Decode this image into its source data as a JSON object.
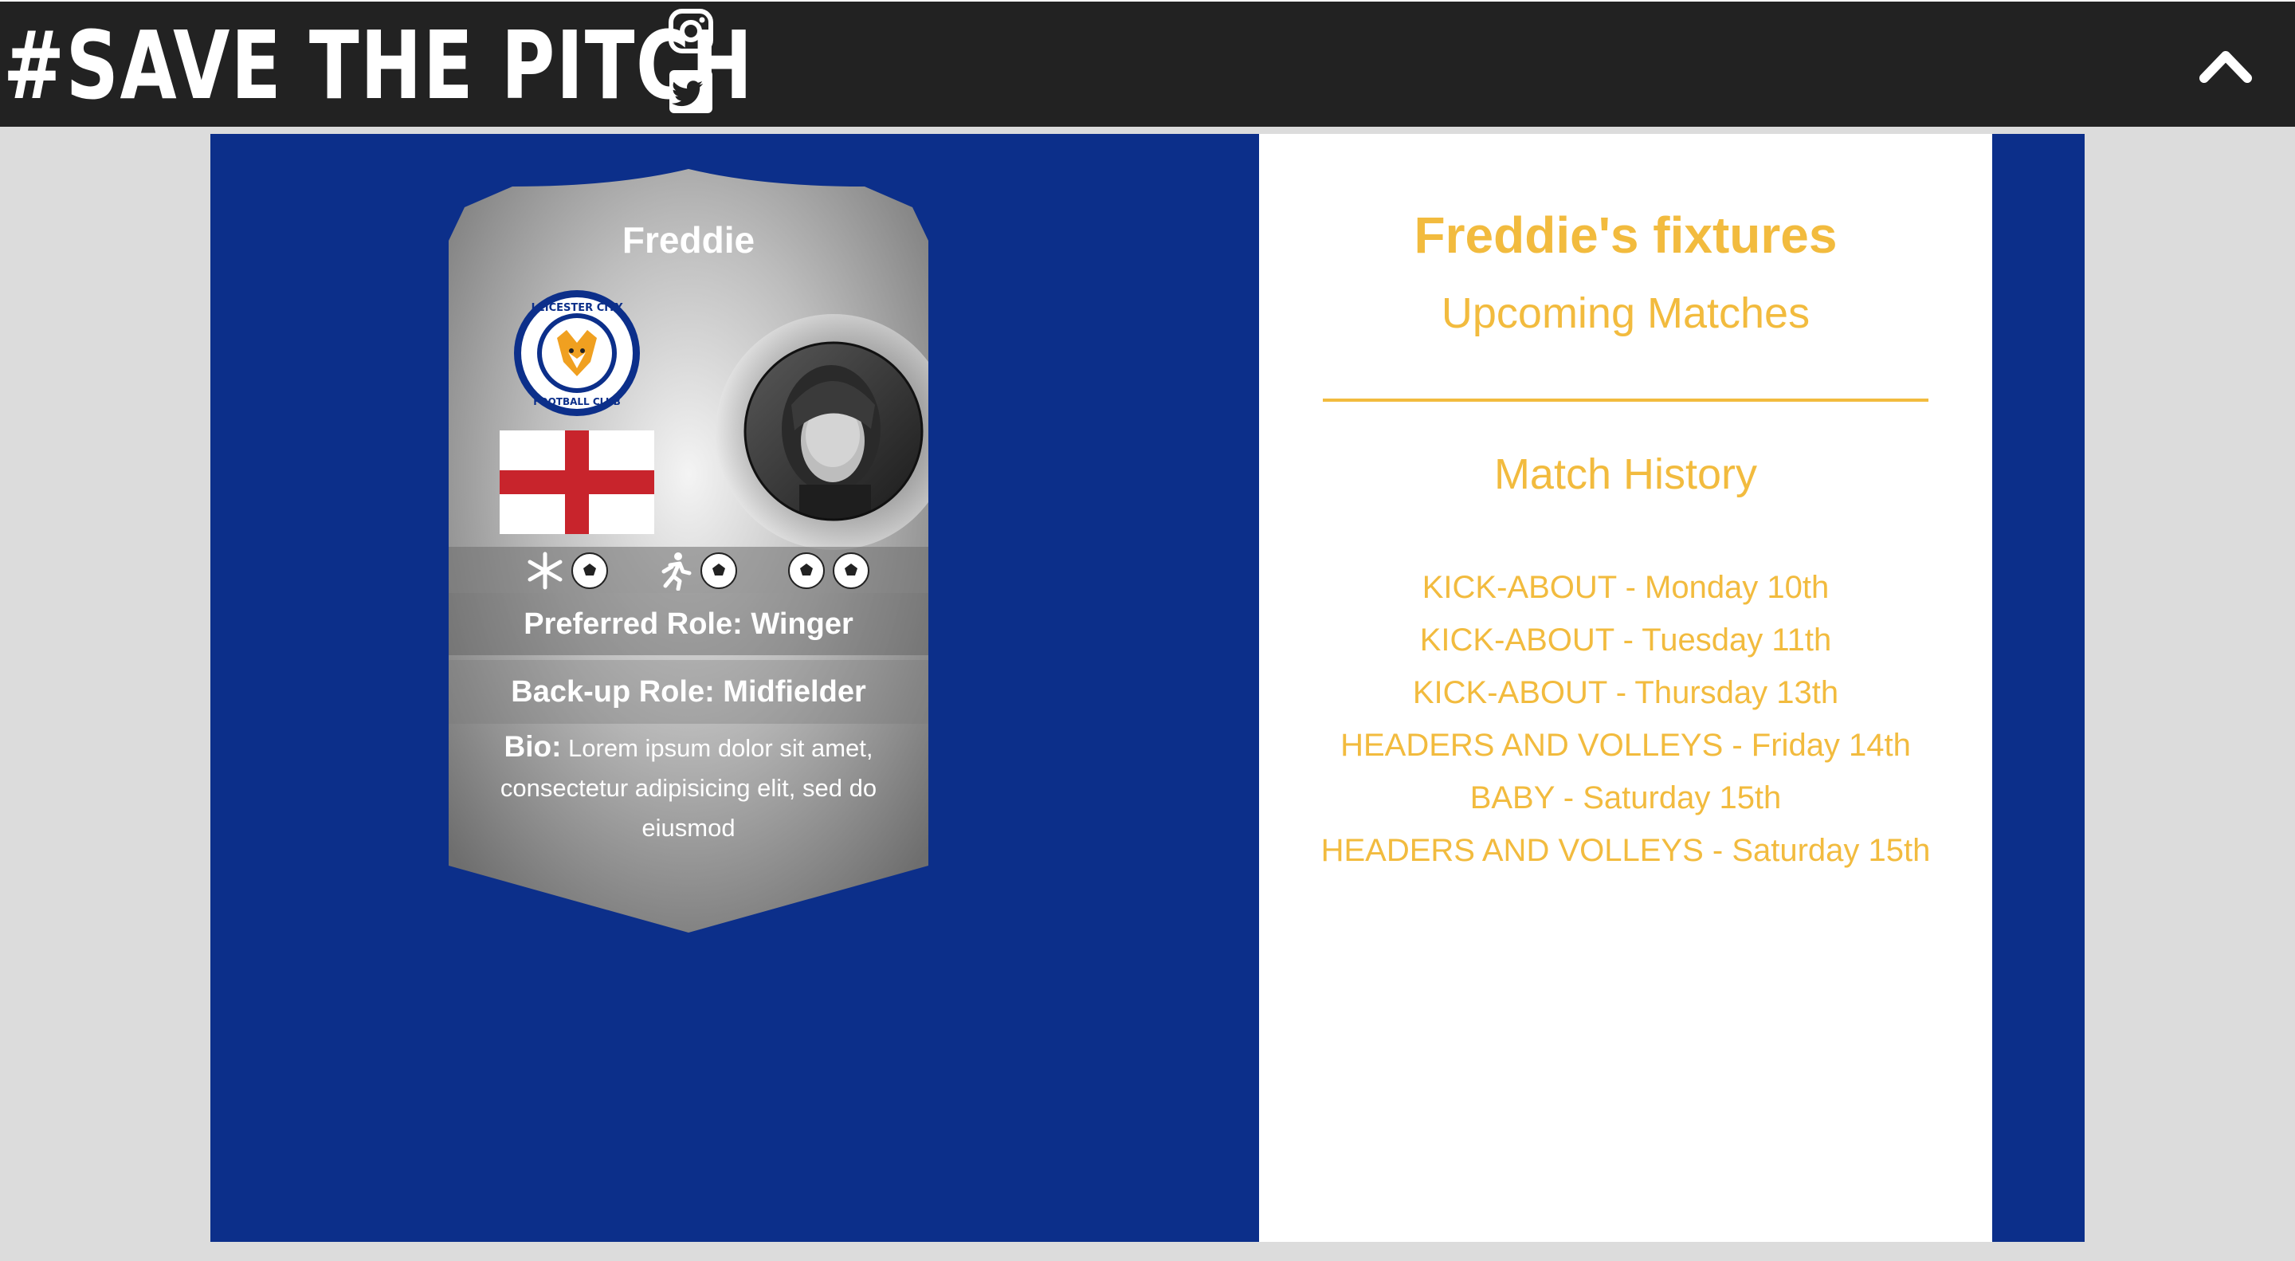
{
  "header": {
    "brand": "#SAVE THE PITCH",
    "social_icons": [
      "instagram-icon",
      "twitter-icon"
    ],
    "collapse_icon": "chevron-up-icon"
  },
  "colors": {
    "header_bg": "#222222",
    "team_blue": "#0c2f8a",
    "accent_gold": "#f2bb3e",
    "page_bg": "#dcdcdc"
  },
  "card": {
    "name": "Freddie",
    "club_badge_icon": "leicester-city-badge",
    "club_badge_text": "LEICESTER CITY FOOTBALL CLUB",
    "flag": "england-flag",
    "stats_icons": [
      "snowflake-ball",
      "running-ball",
      "two-balls"
    ],
    "preferred_role": "Preferred Role: Winger",
    "backup_role": "Back-up Role: Midfielder",
    "bio_label": "Bio:",
    "bio_text": "Lorem ipsum dolor sit amet, consectetur adipisicing elit, sed do eiusmod"
  },
  "fixtures": {
    "title": "Freddie's fixtures",
    "upcoming_label": "Upcoming Matches",
    "history_label": "Match History",
    "history": [
      "KICK-ABOUT - Monday 10th",
      "KICK-ABOUT - Tuesday 11th",
      "KICK-ABOUT - Thursday 13th",
      "HEADERS AND VOLLEYS - Friday 14th",
      "BABY - Saturday 15th",
      "HEADERS AND VOLLEYS - Saturday 15th"
    ]
  }
}
